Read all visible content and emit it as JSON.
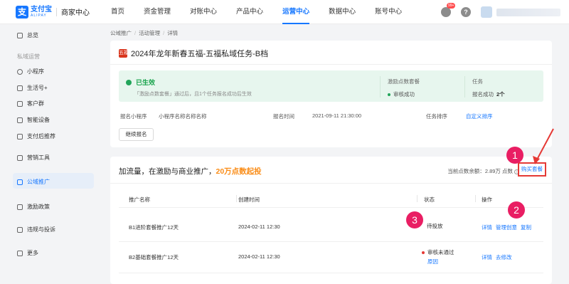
{
  "header": {
    "logo_cn": "支付宝",
    "logo_en": "ALIPAY",
    "logo_sub": "商家中心",
    "nav": [
      {
        "label": "首页"
      },
      {
        "label": "资金管理"
      },
      {
        "label": "对账中心"
      },
      {
        "label": "产品中心"
      },
      {
        "label": "运营中心"
      },
      {
        "label": "数据中心"
      },
      {
        "label": "账号中心"
      }
    ],
    "badge": "99+",
    "help": "?"
  },
  "sidebar": {
    "overview": "总览",
    "group_private": "私域运营",
    "mini_program": "小程序",
    "life_account": "生活号+",
    "customer_group": "客户群",
    "smart_device": "智能设备",
    "after_pay": "支付后推荐",
    "marketing_tools": "营销工具",
    "public_promo": "公域推广",
    "incentive": "激励政策",
    "violations": "违规与投诉",
    "more": "更多"
  },
  "breadcrumb": [
    "公域推广",
    "活动管理",
    "详情"
  ],
  "task": {
    "icon_text": "五福",
    "title": "2024年龙年新春五福-五福私域任务-B档",
    "status": "已生效",
    "status_desc": "「激励点数套餐」通过后，且1个任务报名成功后生效",
    "pkg_label": "激励点数套餐",
    "pkg_value": "审核成功",
    "task_label": "任务",
    "task_value": "报名成功",
    "task_count": "2个",
    "mp_label": "报名小程序",
    "mp_value": "小程序名称名称名称",
    "time_label": "报名时间",
    "time_value": "2021-09-11 21:30:00",
    "sort_label": "任务排序",
    "sort_link": "自定义排序",
    "continue_btn": "继续报名"
  },
  "promo": {
    "title_pre": "加流量，在激励与商业推广，",
    "title_hl": "20万点数起投",
    "balance_label": "当前点数余额：",
    "balance_value": "2.89万 点数",
    "info_icon": "i",
    "buy_link": "购买套餐",
    "headers": {
      "name": "推广名称",
      "created": "创建时间",
      "status": "状态",
      "ops": "操作"
    },
    "rows": [
      {
        "name": "B1进阶套餐推广12天",
        "created": "2024-02-11 12:30",
        "status": "待投放",
        "ops": [
          "详情",
          "管理创意",
          "复制"
        ]
      },
      {
        "name": "B2基础套餐推广12天",
        "created": "2024-02-11 12:30",
        "status": "审核未通过",
        "status_link": "原因",
        "ops": [
          "详情",
          "去修改"
        ]
      }
    ]
  },
  "annotations": [
    "1",
    "2",
    "3"
  ],
  "colors": {
    "accent": "#1677ff",
    "success": "#22a55a",
    "highlight": "#fa8c16",
    "annotation": "#e91e63",
    "alert": "#e53935"
  }
}
